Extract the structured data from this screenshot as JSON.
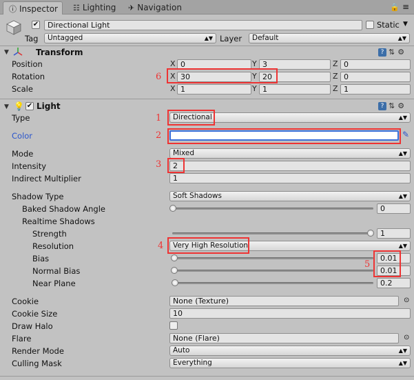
{
  "tabs": [
    {
      "label": "Inspector",
      "icon": "info-icon",
      "active": true
    },
    {
      "label": "Lighting",
      "icon": "lighting-icon",
      "active": false
    },
    {
      "label": "Navigation",
      "icon": "navigation-icon",
      "active": false
    }
  ],
  "object": {
    "name": "Directional Light",
    "static_label": "Static",
    "tag_label": "Tag",
    "tag_value": "Untagged",
    "layer_label": "Layer",
    "layer_value": "Default"
  },
  "transform": {
    "title": "Transform",
    "position": {
      "label": "Position",
      "x": "0",
      "y": "3",
      "z": "0"
    },
    "rotation": {
      "label": "Rotation",
      "x": "30",
      "y": "20",
      "z": "0"
    },
    "scale": {
      "label": "Scale",
      "x": "1",
      "y": "1",
      "z": "1"
    },
    "axis_x": "X",
    "axis_y": "Y",
    "axis_z": "Z"
  },
  "light": {
    "title": "Light",
    "type_label": "Type",
    "type_value": "Directional",
    "color_label": "Color",
    "mode_label": "Mode",
    "mode_value": "Mixed",
    "intensity_label": "Intensity",
    "intensity_value": "2",
    "indirect_label": "Indirect Multiplier",
    "indirect_value": "1",
    "shadow_type_label": "Shadow Type",
    "shadow_type_value": "Soft Shadows",
    "baked_angle_label": "Baked Shadow Angle",
    "baked_angle_value": "0",
    "baked_angle_fraction": 0,
    "realtime_label": "Realtime Shadows",
    "strength_label": "Strength",
    "strength_value": "1",
    "strength_fraction": 1,
    "resolution_label": "Resolution",
    "resolution_value": "Very High Resolution",
    "bias_label": "Bias",
    "bias_value": "0.01",
    "normal_bias_label": "Normal Bias",
    "normal_bias_value": "0.01",
    "near_plane_label": "Near Plane",
    "near_plane_value": "0.2",
    "cookie_label": "Cookie",
    "cookie_value": "None (Texture)",
    "cookie_size_label": "Cookie Size",
    "cookie_size_value": "10",
    "draw_halo_label": "Draw Halo",
    "flare_label": "Flare",
    "flare_value": "None (Flare)",
    "render_mode_label": "Render Mode",
    "render_mode_value": "Auto",
    "culling_label": "Culling Mask",
    "culling_value": "Everything"
  },
  "annotations": [
    "1",
    "2",
    "3",
    "4",
    "5",
    "6"
  ],
  "colors": {
    "annotation": "#e33333",
    "color_label": "#2a55cc",
    "panel": "#c2c2c2"
  }
}
